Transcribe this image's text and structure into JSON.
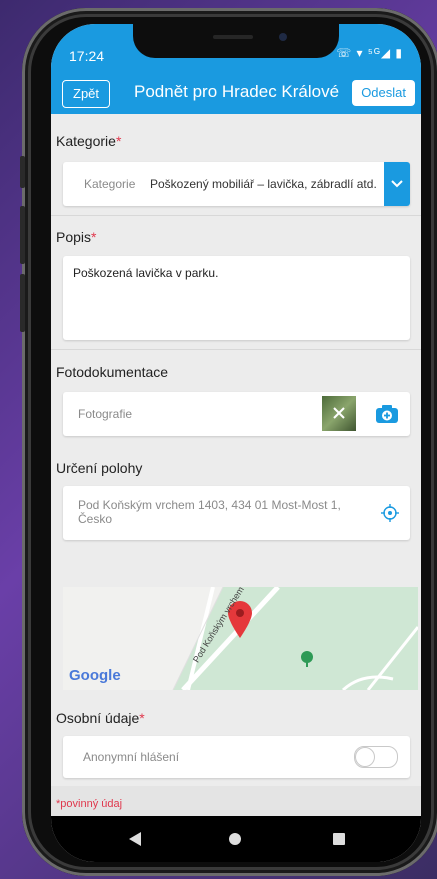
{
  "status": {
    "time": "17:24",
    "icons": "☏ ▾ ⁵ᴳ◢ ▮"
  },
  "appbar": {
    "back_label": "Zpět",
    "title": "Podnět pro Hradec Králové",
    "send_label": "Odeslat"
  },
  "category": {
    "label": "Kategorie",
    "required_mark": "*",
    "field_label": "Kategorie",
    "value": "Poškozený mobiliář – lavička, zábradlí atd."
  },
  "description": {
    "label": "Popis",
    "required_mark": "*",
    "value": "Poškozená lavička v parku."
  },
  "photos": {
    "label": "Fotodokumentace",
    "field_label": "Fotografie"
  },
  "location": {
    "label": "Určení polohy",
    "address_line1": "Pod Koňským vrchem 1403, 434 01 Most-Most 1,",
    "address_line2": "Česko"
  },
  "map": {
    "logo_text": "Google",
    "street_label": "Pod Koňským vrchem"
  },
  "personal": {
    "label": "Osobní údaje",
    "required_mark": "*",
    "anonymous_label": "Anonymní hlášení",
    "anonymous_on": false
  },
  "footer": {
    "required_note": "*povinný údaj"
  },
  "colors": {
    "accent": "#1a9ae0",
    "required": "#e0384d"
  }
}
